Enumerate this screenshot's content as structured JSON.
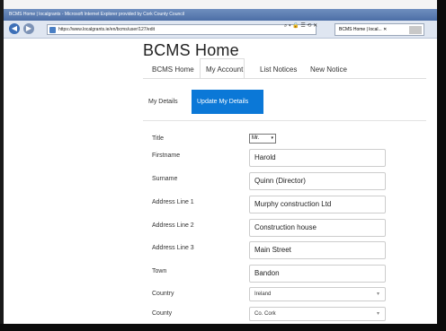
{
  "browser": {
    "window_title": "BCMS Home | localgrants - Microsoft Internet Explorer provided by Cork County Council",
    "address": "https://www.localgrants.ie/en/bcms/user/127/edit",
    "tab_title": "BCMS Home | local... ✕",
    "toolbar_icons": "⌕ ▾ 🔒 ☰ ⟲ ✕",
    "back_glyph": "◀",
    "forward_glyph": "▶"
  },
  "site": {
    "brand": "BCMS Home",
    "nav": [
      "BCMS Home",
      "My Account",
      "List Notices",
      "New Notice"
    ],
    "active_nav": "My Account"
  },
  "subnav": {
    "my_details": "My Details",
    "update_my_details": "Update My Details"
  },
  "form": {
    "title": {
      "label": "Title",
      "value": "Mr."
    },
    "firstname": {
      "label": "Firstname",
      "value": "Harold"
    },
    "surname": {
      "label": "Surname",
      "value": "Quinn (Director)"
    },
    "address1": {
      "label": "Address Line 1",
      "value": "Murphy construction Ltd"
    },
    "address2": {
      "label": "Address Line 2",
      "value": "Construction house"
    },
    "address3": {
      "label": "Address Line 3",
      "value": "Main Street"
    },
    "town": {
      "label": "Town",
      "value": "Bandon"
    },
    "country": {
      "label": "Country",
      "value": "Ireland"
    },
    "county": {
      "label": "County",
      "value": "Co. Cork"
    }
  },
  "colors": {
    "accent": "#0b78d7"
  }
}
